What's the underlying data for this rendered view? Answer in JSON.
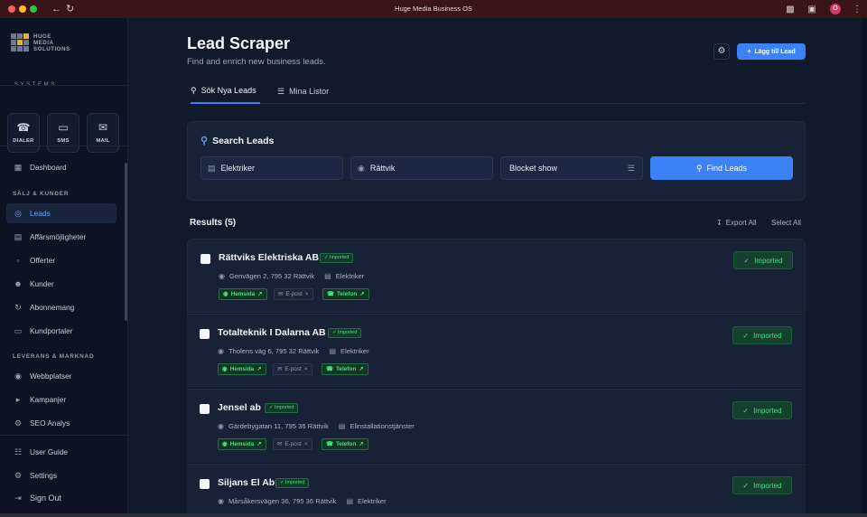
{
  "window": {
    "title": "Huge Media Business OS",
    "avatar_letter": "O"
  },
  "brand": {
    "line1": "HUGE",
    "line2": "MEDIA",
    "line3": "SOLUTIONS",
    "sub": "SYSTEMS",
    "accent": "#e1b32b"
  },
  "quick_actions": [
    {
      "label": "DIALER",
      "icon": "phone-icon"
    },
    {
      "label": "SMS",
      "icon": "message-icon"
    },
    {
      "label": "MAIL",
      "icon": "mail-icon"
    }
  ],
  "nav": {
    "dashboard": "Dashboard",
    "section_sales": "SÄLJ & KUNDER",
    "leads": "Leads",
    "opportunities": "Affärsmöjligheter",
    "offers": "Offerter",
    "customers": "Kunder",
    "subscriptions": "Abonnemang",
    "portals": "Kundportaler",
    "section_delivery": "LEVERANS & MARKNAD",
    "websites": "Webbplatser",
    "campaigns": "Kampanjer",
    "seo": "SEO Analys",
    "guide": "User Guide",
    "settings": "Settings",
    "signout": "Sign Out"
  },
  "header": {
    "title": "Lead Scraper",
    "subtitle": "Find and enrich new business leads.",
    "add_label": "Lägg till Lead"
  },
  "tabs": {
    "search": "Sök Nya Leads",
    "lists": "Mina Listor"
  },
  "search": {
    "title": "Search Leads",
    "industry": "Elektriker",
    "location": "Rättvik",
    "source": "Blocket show",
    "button": "Find Leads"
  },
  "results": {
    "label": "Results (5)",
    "export": "Export All",
    "select": "Select All"
  },
  "leads": [
    {
      "name": "Rättviks Elektriska AB",
      "badge": "Imported",
      "address": "Genvägen 2, 795 32 Rättvik",
      "category": "Elektriker",
      "web": "Hemsida",
      "email": "E-post",
      "phone": "Telefon",
      "status": "Imported"
    },
    {
      "name": "Totalteknik I Dalarna AB",
      "badge": "Imported",
      "address": "Tholens väg 6, 795 32 Rättvik",
      "category": "Elektriker",
      "web": "Hemsida",
      "email": "E-post",
      "phone": "Telefon",
      "status": "Imported"
    },
    {
      "name": "Jensel ab",
      "badge": "Imported",
      "address": "Gärdebygatan 11, 795 36 Rättvik",
      "category": "Elinstallationstjänster",
      "web": "Hemsida",
      "email": "E-post",
      "phone": "Telefon",
      "status": "Imported"
    },
    {
      "name": "Siljans El Ab",
      "badge": "Imported",
      "address": "Mårsåkersvägen 36, 795 36 Rättvik",
      "category": "Elektriker",
      "status": "Imported"
    }
  ],
  "colors": {
    "primary": "#3b82f6",
    "success": "#4ade80",
    "titlebar": "#3a1517"
  }
}
